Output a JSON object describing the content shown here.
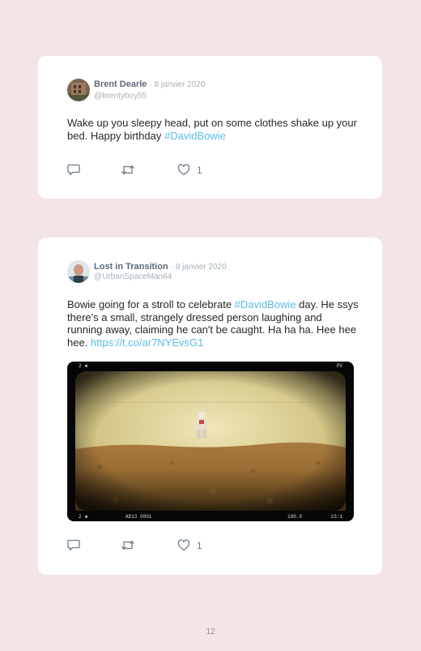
{
  "tweets": [
    {
      "name": "Brent Dearle",
      "date": "· 8 janvier 2020",
      "handle": "@brentyboy55",
      "text_before": "Wake up you sleepy head, put on some clothes shake up your bed. Happy birthday ",
      "hashtag": "#DavidBowie",
      "likes": "1"
    },
    {
      "name": "Lost in Transition",
      "date": "· 8 janvier 2020",
      "handle": "@UrbanSpaceMan64",
      "text_before": "Bowie going for a stroll to celebrate ",
      "hashtag": "#DavidBowie",
      "text_after": " day. He ssys there's a small, strangely dressed person laughing and running away, claiming he can't be caught. Ha ha ha. Hee hee hee. ",
      "link": "https://t.co/ar7NYEvsG1",
      "likes": "1",
      "photo_osd": {
        "top_left": "2 ◄",
        "top_right": "PV",
        "bottom_left": "2 ◄",
        "bottom_center": "AD13  0001",
        "bottom_mid_right": "180.0",
        "bottom_right": "23:1"
      }
    }
  ],
  "page_number": "12",
  "colors": {
    "background": "#f3e5e4",
    "card": "#ffffff",
    "hashtag": "#5bbce4",
    "name": "#5c6b78"
  },
  "icons": [
    "reply-icon",
    "retweet-icon",
    "heart-icon"
  ]
}
